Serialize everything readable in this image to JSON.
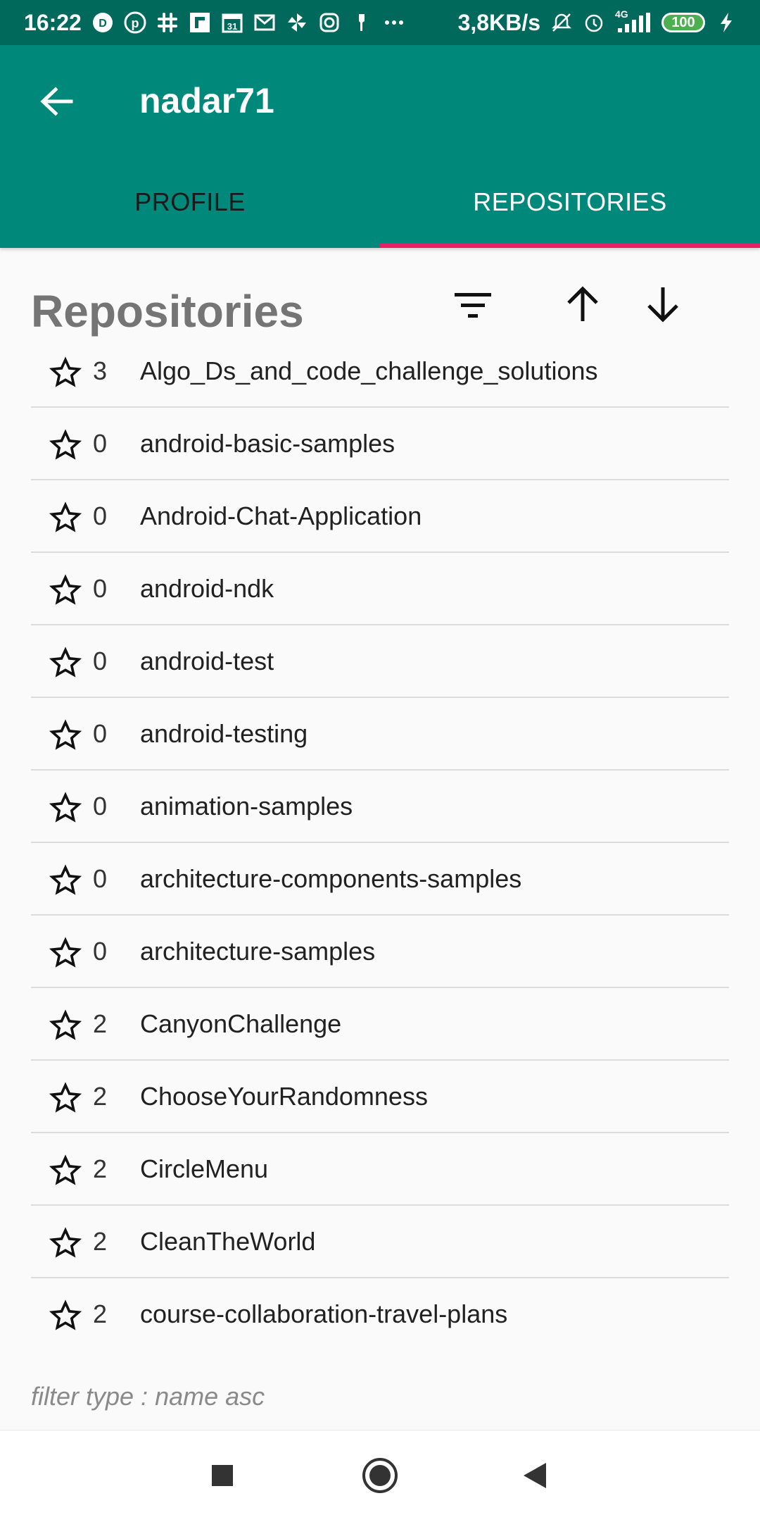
{
  "status_bar": {
    "time": "16:22",
    "network_speed": "3,8KB/s",
    "network_type": "4G",
    "battery": "100",
    "icons_left": [
      "d-app-icon",
      "pinterest-icon",
      "slack-icon",
      "flipboard-icon",
      "calendar-icon",
      "gmail-icon",
      "pinwheel-icon",
      "instagram-icon",
      "fist-icon",
      "more-dots-icon"
    ],
    "icons_right": [
      "mute-icon",
      "alarm-icon",
      "signal-icon",
      "battery-icon",
      "charging-icon"
    ]
  },
  "app_bar": {
    "title": "nadar71",
    "back_icon": "arrow-back-icon"
  },
  "tabs": [
    {
      "label": "PROFILE",
      "active": false
    },
    {
      "label": "REPOSITORIES",
      "active": true
    }
  ],
  "colors": {
    "primary": "#00897b",
    "primary_dark": "#00695c",
    "accent": "#e91e63"
  },
  "section": {
    "title": "Repositories",
    "controls": [
      "filter-icon",
      "sort-ascending-icon",
      "sort-descending-icon"
    ]
  },
  "repositories": [
    {
      "stars": "3",
      "name": "Algo_Ds_and_code_challenge_solutions"
    },
    {
      "stars": "0",
      "name": "android-basic-samples"
    },
    {
      "stars": "0",
      "name": "Android-Chat-Application"
    },
    {
      "stars": "0",
      "name": "android-ndk"
    },
    {
      "stars": "0",
      "name": "android-test"
    },
    {
      "stars": "0",
      "name": "android-testing"
    },
    {
      "stars": "0",
      "name": "animation-samples"
    },
    {
      "stars": "0",
      "name": "architecture-components-samples"
    },
    {
      "stars": "0",
      "name": "architecture-samples"
    },
    {
      "stars": "2",
      "name": "CanyonChallenge"
    },
    {
      "stars": "2",
      "name": "ChooseYourRandomness"
    },
    {
      "stars": "2",
      "name": "CircleMenu"
    },
    {
      "stars": "2",
      "name": "CleanTheWorld"
    },
    {
      "stars": "2",
      "name": "course-collaboration-travel-plans"
    }
  ],
  "footer_note": "filter type : name asc",
  "nav_bar": {
    "buttons": [
      "recents-square-icon",
      "home-circle-icon",
      "back-triangle-icon"
    ]
  }
}
